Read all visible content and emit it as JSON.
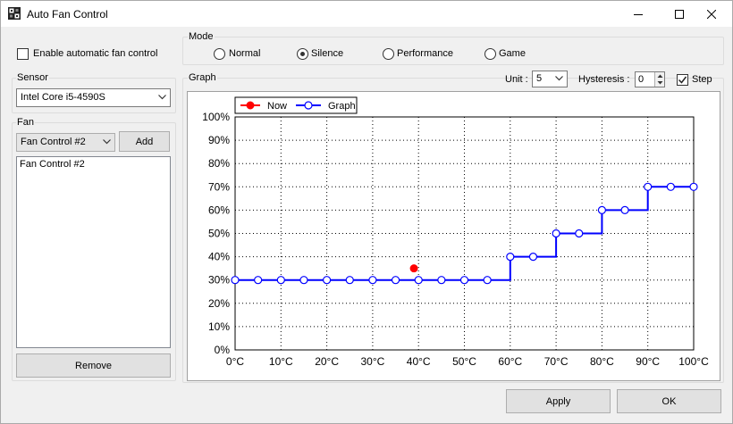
{
  "window": {
    "title": "Auto Fan Control"
  },
  "enable_checkbox": {
    "label": "Enable automatic fan control",
    "checked": false
  },
  "mode": {
    "group_label": "Mode",
    "options": [
      {
        "label": "Normal",
        "selected": false
      },
      {
        "label": "Silence",
        "selected": true
      },
      {
        "label": "Performance",
        "selected": false
      },
      {
        "label": "Game",
        "selected": false
      }
    ]
  },
  "sensor": {
    "group_label": "Sensor",
    "selected": "Intel Core i5-4590S"
  },
  "fan": {
    "group_label": "Fan",
    "selected": "Fan Control #2",
    "add_label": "Add",
    "list": [
      "Fan Control #2"
    ],
    "remove_label": "Remove"
  },
  "graph": {
    "group_label": "Graph",
    "unit_label": "Unit :",
    "unit_value": "5",
    "hysteresis_label": "Hysteresis :",
    "hysteresis_value": "0",
    "step_label": "Step",
    "step_checked": true
  },
  "chart_data": {
    "type": "line",
    "step": true,
    "x_ticks": [
      "0°C",
      "10°C",
      "20°C",
      "30°C",
      "40°C",
      "50°C",
      "60°C",
      "70°C",
      "80°C",
      "90°C",
      "100°C"
    ],
    "y_ticks": [
      "0%",
      "10%",
      "20%",
      "30%",
      "40%",
      "50%",
      "60%",
      "70%",
      "80%",
      "90%",
      "100%"
    ],
    "xlim": [
      0,
      100
    ],
    "ylim": [
      0,
      100
    ],
    "grid": true,
    "legend": "top-left",
    "series": [
      {
        "name": "Now",
        "color": "#ff0000",
        "marker": "filled-circle",
        "points": [
          {
            "x": 39,
            "y": 35
          }
        ]
      },
      {
        "name": "Graph",
        "color": "#0000ff",
        "marker": "hollow-circle",
        "points": [
          {
            "x": 0,
            "y": 30
          },
          {
            "x": 5,
            "y": 30
          },
          {
            "x": 10,
            "y": 30
          },
          {
            "x": 15,
            "y": 30
          },
          {
            "x": 20,
            "y": 30
          },
          {
            "x": 25,
            "y": 30
          },
          {
            "x": 30,
            "y": 30
          },
          {
            "x": 35,
            "y": 30
          },
          {
            "x": 40,
            "y": 30
          },
          {
            "x": 45,
            "y": 30
          },
          {
            "x": 50,
            "y": 30
          },
          {
            "x": 55,
            "y": 30
          },
          {
            "x": 60,
            "y": 40
          },
          {
            "x": 65,
            "y": 40
          },
          {
            "x": 70,
            "y": 50
          },
          {
            "x": 75,
            "y": 50
          },
          {
            "x": 80,
            "y": 60
          },
          {
            "x": 85,
            "y": 60
          },
          {
            "x": 90,
            "y": 70
          },
          {
            "x": 95,
            "y": 70
          },
          {
            "x": 100,
            "y": 70
          }
        ]
      }
    ]
  },
  "footer": {
    "apply_label": "Apply",
    "ok_label": "OK"
  }
}
